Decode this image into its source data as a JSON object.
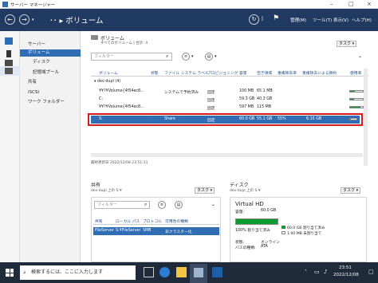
{
  "window": {
    "title": "サーバー マネージャー",
    "controls": [
      "–",
      "□",
      "×"
    ]
  },
  "nav": {
    "back": "←",
    "forward": "→",
    "breadcrumb": "･･ ▸ ボリューム",
    "toolbar": [
      "管理(M)",
      "ツール(T)",
      "表示(V)",
      "ヘルプ(H)"
    ]
  },
  "navpane": {
    "items": [
      {
        "label": "サーバー",
        "selected": false,
        "sub": false
      },
      {
        "label": "ボリューム",
        "selected": true,
        "sub": false
      },
      {
        "label": "ディスク",
        "selected": false,
        "sub": true
      },
      {
        "label": "記憶域プール",
        "selected": false,
        "sub": true
      },
      {
        "label": "共有",
        "selected": false,
        "sub": false
      },
      {
        "label": "iSCSI",
        "selected": false,
        "sub": false
      },
      {
        "label": "ワーク フォルダー",
        "selected": false,
        "sub": false
      }
    ]
  },
  "volumes": {
    "title": "ボリューム",
    "subtitle": "すべてのボリューム | 合計: 4",
    "task_button": "タスク ▾",
    "filter_placeholder": "フィルター",
    "columns": [
      "ボリューム",
      "状態",
      "ファイル システム ラベル",
      "プロビジョニング",
      "容量",
      "空き領域",
      "重複除去率",
      "重複除去による節約",
      "使用率"
    ],
    "group": "▾ dev-dupl (4)",
    "rows": [
      {
        "volume": "¥¥?¥Volume{4f54ec8...",
        "status": "",
        "label": "システムで予約済み",
        "prov": "固定",
        "capacity": "100 MB",
        "free": "65.1 MB",
        "rate": "",
        "savings": "",
        "usage": 0.35,
        "selected": false
      },
      {
        "volume": "C:",
        "status": "",
        "label": "",
        "prov": "固定",
        "capacity": "59.3 GB",
        "free": "40.3 GB",
        "rate": "",
        "savings": "",
        "usage": 0.32,
        "selected": false
      },
      {
        "volume": "¥¥?¥Volume{4f54ec8...",
        "status": "",
        "label": "",
        "prov": "固定",
        "capacity": "597 MB",
        "free": "115 MB",
        "rate": "",
        "savings": "",
        "usage": 0.81,
        "selected": false
      },
      {
        "volume": "S:",
        "status": "",
        "label": "Share",
        "prov": "固定",
        "capacity": "60.0 GB",
        "free": "55.1 GB",
        "rate": "55%",
        "savings": "6.15 GB",
        "usage": 0.08,
        "selected": true
      }
    ],
    "last_updated": "最終更新日 2022/12/08 23:51:11"
  },
  "shares": {
    "title": "共有",
    "subtitle": "dev-dupl 上の S:¥",
    "task_button": "タスク ▾",
    "filter_placeholder": "フィルター",
    "columns": [
      "共有",
      "ローカル パス",
      "プロトコル",
      "可用性の種類"
    ],
    "rows": [
      {
        "share": "FileServer",
        "path": "S:¥FileServer",
        "protocol": "SMB",
        "availability": "非クラスター化"
      }
    ]
  },
  "disk": {
    "title": "ディスク",
    "subtitle": "dev-dupl 上の S:¥",
    "task_button": "タスク ▾",
    "name": "Virtual HD",
    "capacity_label": "容量:",
    "capacity": "60.0 GB",
    "bar_fraction": 1.0,
    "alloc_label": "100% 割り当て済み",
    "legend": [
      "60.0 GB 割り当て済み",
      "1.00 MB 未割り当て"
    ],
    "status_label": "状態:",
    "status": "オンライン",
    "bus_label": "バスの種類:",
    "bus": "ATA"
  },
  "taskbar": {
    "search_placeholder": "検索するには、ここに入力します",
    "time": "23:51",
    "date": "2022/12/08"
  },
  "colors": {
    "navbar": "#203a62",
    "selection": "#2f6eb5",
    "highlight": "#d91b1b",
    "usage": "#0b9c2f"
  }
}
